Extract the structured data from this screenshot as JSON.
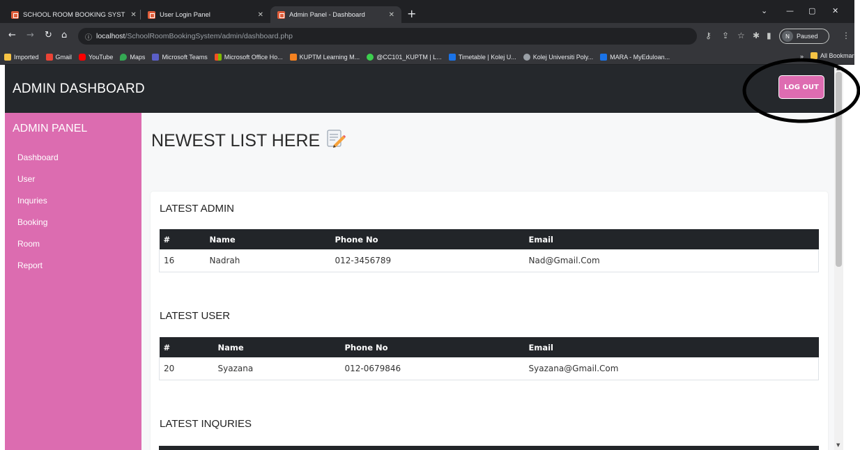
{
  "browser": {
    "tabs": [
      {
        "title": "SCHOOL ROOM BOOKING SYST"
      },
      {
        "title": "User Login Panel"
      },
      {
        "title": "Admin Panel - Dashboard"
      }
    ],
    "url_host": "localhost",
    "url_path": "/SchoolRoomBookingSystem/admin/dashboard.php",
    "profile_initial": "N",
    "profile_status": "Paused",
    "bookmarks": [
      {
        "label": "Imported",
        "color": "#f6c344"
      },
      {
        "label": "Gmail",
        "color": "#ea4335"
      },
      {
        "label": "YouTube",
        "color": "#ff0000"
      },
      {
        "label": "Maps",
        "color": "#34a853"
      },
      {
        "label": "Microsoft Teams",
        "color": "#5b5fc7"
      },
      {
        "label": "Microsoft Office Ho...",
        "color": "#f25022"
      },
      {
        "label": "KUPTM Learning M...",
        "color": "#f58220"
      },
      {
        "label": "@CC101_KUPTM | L...",
        "color": "#3ccf4e"
      },
      {
        "label": "Timetable | Kolej U...",
        "color": "#1a73e8"
      },
      {
        "label": "Kolej Universiti Poly...",
        "color": "#9aa0a6"
      },
      {
        "label": "MARA - MyEduloan...",
        "color": "#1a73e8"
      }
    ],
    "bookmarks_more": "»",
    "all_bookmarks": "All Bookmarks"
  },
  "header": {
    "title": "ADMIN DASHBOARD",
    "logout_label": "LOG OUT"
  },
  "sidebar": {
    "title": "ADMIN PANEL",
    "items": [
      {
        "label": "Dashboard"
      },
      {
        "label": "User"
      },
      {
        "label": "Inquries"
      },
      {
        "label": "Booking"
      },
      {
        "label": "Room"
      },
      {
        "label": "Report"
      }
    ]
  },
  "main": {
    "title": "NEWEST LIST HERE",
    "sections": {
      "admin": {
        "title": "LATEST ADMIN",
        "columns": [
          "#",
          "Name",
          "Phone No",
          "Email"
        ],
        "rows": [
          [
            "16",
            "Nadrah",
            "012-3456789",
            "Nad@Gmail.Com"
          ]
        ]
      },
      "user": {
        "title": "LATEST USER",
        "columns": [
          "#",
          "Name",
          "Phone No",
          "Email"
        ],
        "rows": [
          [
            "20",
            "Syazana",
            "012-0679846",
            "Syazana@Gmail.Com"
          ]
        ]
      },
      "inquiries": {
        "title": "LATEST INQURIES"
      }
    }
  },
  "colors": {
    "sidebar": "#dc6cb0",
    "topbar": "#25282c",
    "logout_button": "#de6cb1",
    "table_header": "#222529"
  }
}
